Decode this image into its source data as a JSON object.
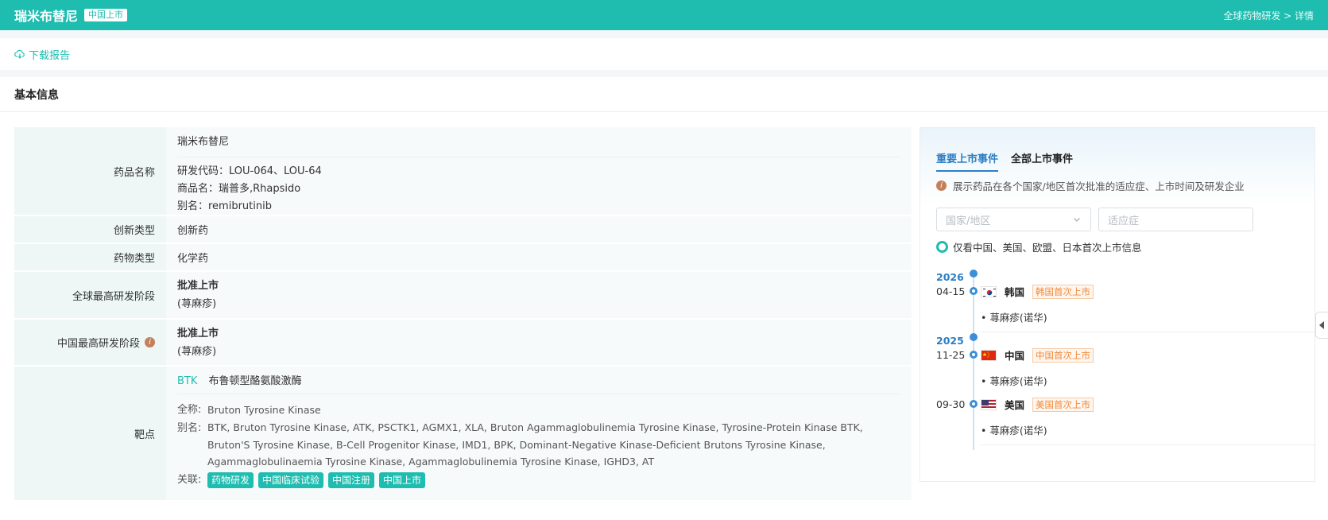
{
  "header": {
    "title": "瑞米布替尼",
    "badge": "中国上市",
    "breadcrumb": "全球药物研发 > 详情"
  },
  "toolbar": {
    "download_label": "下载报告"
  },
  "section": {
    "title": "基本信息"
  },
  "info": {
    "drug_name": {
      "label": "药品名称",
      "name": "瑞米布替尼",
      "codes": "研发代码：LOU-064、LOU-64",
      "trade": "商品名：瑞普多,Rhapsido",
      "alias": "别名：remibrutinib"
    },
    "innovation": {
      "label": "创新类型",
      "value": "创新药"
    },
    "drug_type": {
      "label": "药物类型",
      "value": "化学药"
    },
    "global_stage": {
      "label": "全球最高研发阶段",
      "value": "批准上市",
      "note": "(荨麻疹)"
    },
    "china_stage": {
      "label": "中国最高研发阶段",
      "value": "批准上市",
      "note": "(荨麻疹)",
      "icon": "info-icon"
    },
    "target": {
      "label": "靶点",
      "code": "BTK",
      "name": "布鲁顿型酪氨酸激酶",
      "full_key": "全称:",
      "full_val": "Bruton Tyrosine Kinase",
      "alias_key": "别名:",
      "alias_val": "BTK, Bruton Tyrosine Kinase, ATK, PSCTK1, AGMX1, XLA, Bruton Agammaglobulinemia Tyrosine Kinase, Tyrosine-Protein Kinase BTK, Bruton'S Tyrosine Kinase, B-Cell Progenitor Kinase, IMD1, BPK, Dominant-Negative Kinase-Deficient Brutons Tyrosine Kinase, Agammaglobulinaemia Tyrosine Kinase, Agammaglobulinemia Tyrosine Kinase, IGHD3, AT",
      "rel_key": "关联:",
      "chips": [
        "药物研发",
        "中国临床试验",
        "中国注册",
        "中国上市"
      ]
    }
  },
  "panel": {
    "tabs": [
      "重要上市事件",
      "全部上市事件"
    ],
    "active_tab": 0,
    "description": "展示药品在各个国家/地区首次批准的适应症、上市时间及研发企业",
    "country_placeholder": "国家/地区",
    "indication_placeholder": "适应症",
    "checkbox_label": "仅看中国、美国、欧盟、日本首次上市信息",
    "events": [
      {
        "year": "2026",
        "date": "04-15",
        "country": "韩国",
        "tag": "韩国首次上市",
        "indication": "• 荨麻疹(诺华)",
        "flag": "korea-flag-icon"
      },
      {
        "year": "2025",
        "date": "11-25",
        "country": "中国",
        "tag": "中国首次上市",
        "indication": "• 荨麻疹(诺华)",
        "flag": "china-flag-icon"
      },
      {
        "year": "",
        "date": "09-30",
        "country": "美国",
        "tag": "美国首次上市",
        "indication": "• 荨麻疹(诺华)",
        "flag": "usa-flag-icon"
      }
    ]
  },
  "colors": {
    "accent": "#1fbcb0",
    "blue": "#2b7fc4",
    "tag_orange": "#f08a3b"
  }
}
